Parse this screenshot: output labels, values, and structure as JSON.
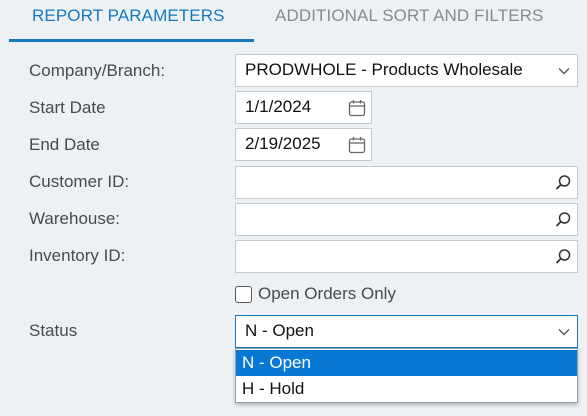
{
  "tabs": [
    {
      "label": "REPORT PARAMETERS",
      "active": true
    },
    {
      "label": "ADDITIONAL SORT AND FILTERS",
      "active": false
    }
  ],
  "form": {
    "company_branch": {
      "label": "Company/Branch:",
      "value": "PRODWHOLE - Products Wholesale",
      "icon": "chevron-down-icon"
    },
    "start_date": {
      "label": "Start Date",
      "value": "1/1/2024",
      "icon": "calendar-icon"
    },
    "end_date": {
      "label": "End Date",
      "value": "2/19/2025",
      "icon": "calendar-icon"
    },
    "customer_id": {
      "label": "Customer ID:",
      "value": "",
      "icon": "search-icon"
    },
    "warehouse": {
      "label": "Warehouse:",
      "value": "",
      "icon": "search-icon"
    },
    "inventory_id": {
      "label": "Inventory ID:",
      "value": "",
      "icon": "search-icon"
    },
    "open_orders_only": {
      "label": "Open Orders Only",
      "checked": false
    },
    "status": {
      "label": "Status",
      "value": "N - Open",
      "icon": "chevron-down-icon"
    }
  },
  "status_dropdown": {
    "options": [
      {
        "label": "N - Open",
        "selected": true
      },
      {
        "label": "H - Hold",
        "selected": false
      }
    ]
  },
  "colors": {
    "accent": "#1479bd",
    "selected_option": "#0878d4",
    "background": "#eef1f4"
  }
}
